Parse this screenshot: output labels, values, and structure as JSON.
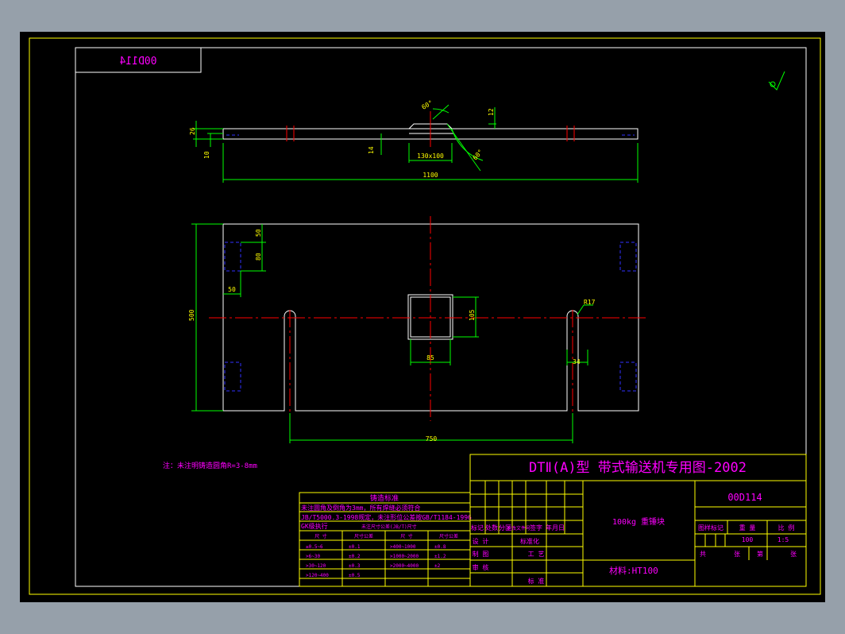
{
  "drawing_number_mirrored": "00D114",
  "side_view": {
    "dim_26": "26",
    "dim_10": "10",
    "dim_14": "14",
    "dim_angle_top": "60°",
    "dim_angle_bottom": "60°",
    "dim_12": "12",
    "dim_slot": "130x100",
    "dim_length": "1100"
  },
  "plan_view": {
    "dim_50_top": "50",
    "dim_80": "80",
    "dim_50_left": "50",
    "dim_500": "500",
    "dim_105": "105",
    "dim_85": "85",
    "dim_R17": "R17",
    "dim_34": "34",
    "dim_750": "750"
  },
  "note": "注：未注明铸造圆角R=3-8mm",
  "casting_standard": {
    "title": "铸造标准",
    "line1": "未注圆角及倒角为3mm，所有焊缝必须符合",
    "line2": "JB/T5000.3-1998规定，未注形位公差按GB/T1184-1996",
    "col_head": "GK级执行",
    "col_head2": "未注尺寸公差(JB/T)尺寸",
    "headers": [
      "尺 寸",
      "尺寸公差",
      "尺 寸",
      "尺寸公差"
    ],
    "rows": [
      [
        "≥0.5~6",
        "±0.1",
        ">400~1000",
        "±0.8"
      ],
      [
        ">6~30",
        "±0.2",
        ">1000~2000",
        "±1.2"
      ],
      [
        ">30~120",
        "±0.3",
        ">2000~4000",
        "±2"
      ],
      [
        ">120~400",
        "±0.5",
        "",
        ""
      ]
    ]
  },
  "title_block": {
    "title": "DTⅡ(A)型  带式输送机专用图-2002",
    "drawing_no": "00D114",
    "part_name": "100kg 重锤块",
    "material": "材料:HT100",
    "rev_headers": [
      "标记",
      "处数",
      "分区",
      "更改文件号",
      "签字",
      "年月日"
    ],
    "design": "设 计",
    "standardization": "标准化",
    "drawing": "制 图",
    "process": "工 艺",
    "review": "审 核",
    "approve": "标 准",
    "stage_mark": "图样标记",
    "weight_label": "重 量",
    "scale_label": "比 例",
    "weight": "100",
    "scale": "1:5",
    "total_label": "共",
    "sheets_label": "张",
    "sheet_no_label": "第",
    "sheet_label": "张"
  }
}
